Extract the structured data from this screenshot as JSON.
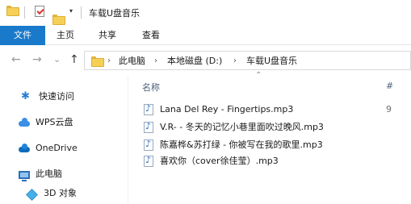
{
  "titlebar": {
    "title": "车载U盘音乐",
    "dropdown_glyph": "▾"
  },
  "ribbon": {
    "tabs": [
      {
        "label": "文件",
        "active": true
      },
      {
        "label": "主页"
      },
      {
        "label": "共享"
      },
      {
        "label": "查看"
      }
    ]
  },
  "navigation": {
    "back_glyph": "←",
    "forward_glyph": "→",
    "recent_glyph": "⌄",
    "up_glyph": "↑"
  },
  "address": {
    "sep_glyph": "›",
    "crumbs": [
      "此电脑",
      "本地磁盘 (D:)",
      "车载U盘音乐"
    ]
  },
  "navpane": {
    "items": [
      {
        "label": "快速访问",
        "icon": "pin-icon"
      },
      {
        "label": "WPS云盘",
        "icon": "wps-cloud-icon"
      },
      {
        "label": "OneDrive",
        "icon": "onedrive-icon"
      },
      {
        "label": "此电脑",
        "icon": "computer-icon"
      },
      {
        "label": "3D 对象",
        "icon": "3d-objects-icon"
      }
    ]
  },
  "filelist": {
    "column_name": "名称",
    "column_number": "#",
    "sort_glyph": "⌃",
    "files": [
      {
        "name": "Lana Del Rey - Fingertips.mp3",
        "number": "9"
      },
      {
        "name": "V.R- - 冬天的记忆小巷里面吹过晚风.mp3",
        "number": ""
      },
      {
        "name": "陈嘉桦&苏打绿 - 你被写在我的歌里.mp3",
        "number": ""
      },
      {
        "name": "喜欢你（cover徐佳莹）.mp3",
        "number": ""
      }
    ]
  },
  "colors": {
    "accent": "#1979ca",
    "folder": "#f6cf57"
  }
}
